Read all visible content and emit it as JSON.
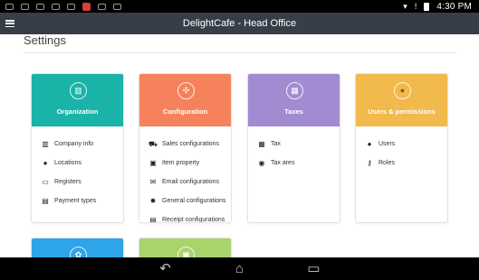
{
  "status_bar": {
    "time": "4:30",
    "period": "PM"
  },
  "app_bar": {
    "title": "DelightCafe - Head Office"
  },
  "page": {
    "title": "Settings"
  },
  "cards": [
    {
      "title": "Organization",
      "color": "#1ab3a8",
      "icon": "building-icon",
      "items": [
        {
          "label": "Company info",
          "icon": "company-icon"
        },
        {
          "label": "Locations",
          "icon": "location-pin-icon"
        },
        {
          "label": "Registers",
          "icon": "register-icon"
        },
        {
          "label": "Payment types",
          "icon": "payment-icon"
        }
      ]
    },
    {
      "title": "Configuration",
      "color": "#f6825c",
      "icon": "configuration-icon",
      "items": [
        {
          "label": "Sales configurations",
          "icon": "cart-icon"
        },
        {
          "label": "Item property",
          "icon": "briefcase-icon"
        },
        {
          "label": "Email configurations",
          "icon": "envelope-icon"
        },
        {
          "label": "General configurations",
          "icon": "gear-icon"
        },
        {
          "label": "Receipt configurations",
          "icon": "receipt-icon"
        }
      ]
    },
    {
      "title": "Taxes",
      "color": "#a38bd2",
      "icon": "calculator-icon",
      "items": [
        {
          "label": "Tax",
          "icon": "calculator-icon"
        },
        {
          "label": "Tax ares",
          "icon": "map-pin-icon"
        }
      ]
    },
    {
      "title": "Users & permissions",
      "color": "#f2b94c",
      "icon": "users-icon",
      "items": [
        {
          "label": "Users",
          "icon": "user-icon"
        },
        {
          "label": "Roles",
          "icon": "key-icon"
        }
      ]
    },
    {
      "title": "",
      "color": "#2ea4ea",
      "icon": "leaf-icon",
      "items": []
    },
    {
      "title": "",
      "color": "#a9d46c",
      "icon": "package-icon",
      "items": []
    }
  ]
}
